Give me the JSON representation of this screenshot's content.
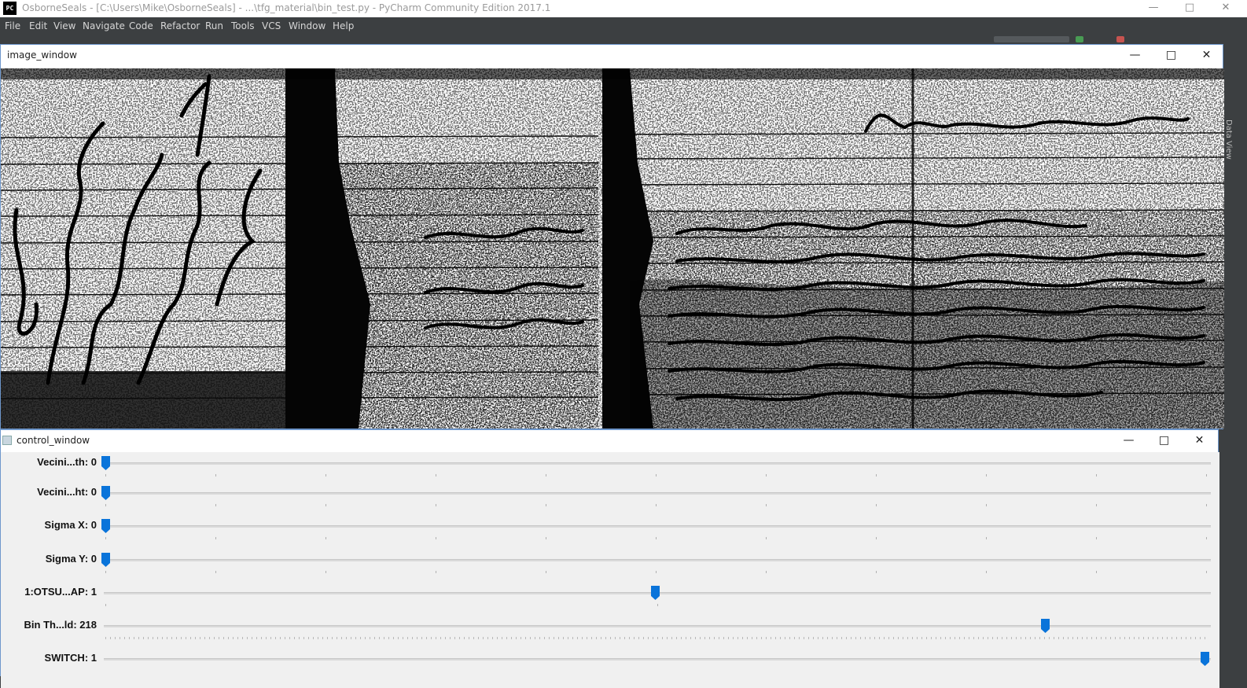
{
  "ide": {
    "window_title": "OsborneSeals - [C:\\Users\\Mike\\OsborneSeals] - ...\\tfg_material\\bin_test.py - PyCharm Community Edition 2017.1",
    "logo_text": "PC",
    "menu": [
      "File",
      "Edit",
      "View",
      "Navigate",
      "Code",
      "Refactor",
      "Run",
      "Tools",
      "VCS",
      "Window",
      "Help"
    ],
    "side_panel_label": "Data View"
  },
  "image_window": {
    "title": "image_window",
    "content": "binarized handwritten manuscript page"
  },
  "control_window": {
    "title": "control_window",
    "trackbars": [
      {
        "label": "Vecini...th: 0",
        "value": 0,
        "fraction": 0.0
      },
      {
        "label": "Vecini...ht: 0",
        "value": 0,
        "fraction": 0.0
      },
      {
        "label": "Sigma X: 0",
        "value": 0,
        "fraction": 0.0
      },
      {
        "label": "Sigma Y: 0",
        "value": 0,
        "fraction": 0.0
      },
      {
        "label": "1:OTSU...AP: 1",
        "value": 1,
        "fraction": 0.5
      },
      {
        "label": "Bin Th...ld: 218",
        "value": 218,
        "fraction": 0.855
      },
      {
        "label": "SWITCH: 1",
        "value": 1,
        "fraction": 1.0
      }
    ]
  },
  "colors": {
    "accent": "#0a74da",
    "ide_background": "#3c3f41",
    "panel_background": "#f0f0f0"
  }
}
